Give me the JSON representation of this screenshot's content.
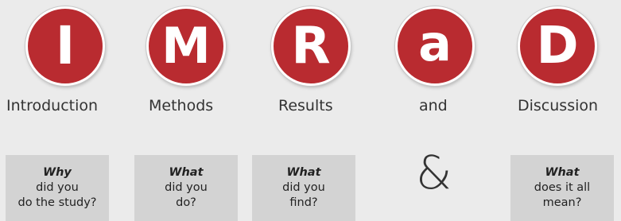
{
  "columns": [
    {
      "letter": "I",
      "word": "Introduction",
      "question": "Why",
      "line1": "did you",
      "line2": "do the study?"
    },
    {
      "letter": "M",
      "word": "Methods",
      "question": "What",
      "line1": "did you",
      "line2": "do?"
    },
    {
      "letter": "R",
      "word": "Results",
      "question": "What",
      "line1": "did you",
      "line2": "find?"
    },
    {
      "letter": "a",
      "word": "and",
      "symbol": "&"
    },
    {
      "letter": "D",
      "word": "Discussion",
      "question": "What",
      "line1": "does it all",
      "line2": "mean?"
    }
  ],
  "colors": {
    "circle": "#b92b30",
    "box": "#d3d3d3",
    "background": "#ebebeb"
  }
}
